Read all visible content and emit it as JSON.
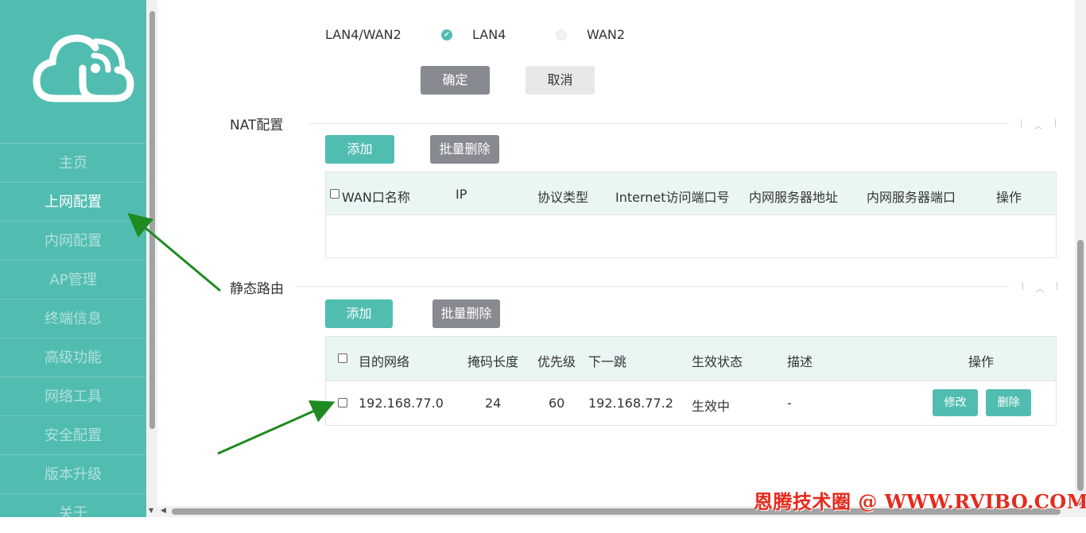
{
  "sidebar": {
    "items": [
      {
        "label": "主页"
      },
      {
        "label": "上网配置"
      },
      {
        "label": "内网配置"
      },
      {
        "label": "AP管理"
      },
      {
        "label": "终端信息"
      },
      {
        "label": "高级功能"
      },
      {
        "label": "网络工具"
      },
      {
        "label": "安全配置"
      },
      {
        "label": "版本升级"
      },
      {
        "label": "关于"
      }
    ],
    "active_index": 1,
    "bg_color": "#51bdb0"
  },
  "port_mode": {
    "label": "LAN4/WAN2",
    "options": [
      "LAN4",
      "WAN2"
    ],
    "selected": "LAN4",
    "confirm_label": "确定",
    "cancel_label": "取消"
  },
  "nat": {
    "title": "NAT配置",
    "add_label": "添加",
    "batch_delete_label": "批量删除",
    "columns": [
      "WAN口名称",
      "IP",
      "协议类型",
      "Internet访问端口号",
      "内网服务器地址",
      "内网服务器端口",
      "操作"
    ],
    "rows": []
  },
  "static_route": {
    "title": "静态路由",
    "add_label": "添加",
    "batch_delete_label": "批量删除",
    "columns": [
      "目的网络",
      "掩码长度",
      "优先级",
      "下一跳",
      "生效状态",
      "描述",
      "操作"
    ],
    "rows": [
      {
        "dest": "192.168.77.0",
        "mask": "24",
        "priority": "60",
        "next_hop": "192.168.77.2",
        "status": "生效中",
        "desc": "-",
        "edit_label": "修改",
        "delete_label": "删除"
      }
    ]
  },
  "watermark": "恩腾技术圈 @ WWW.RVIBO.COM",
  "colors": {
    "accent": "#51bdb0",
    "annotation_arrow": "#1f8a1f",
    "watermark": "#e52a1c"
  }
}
